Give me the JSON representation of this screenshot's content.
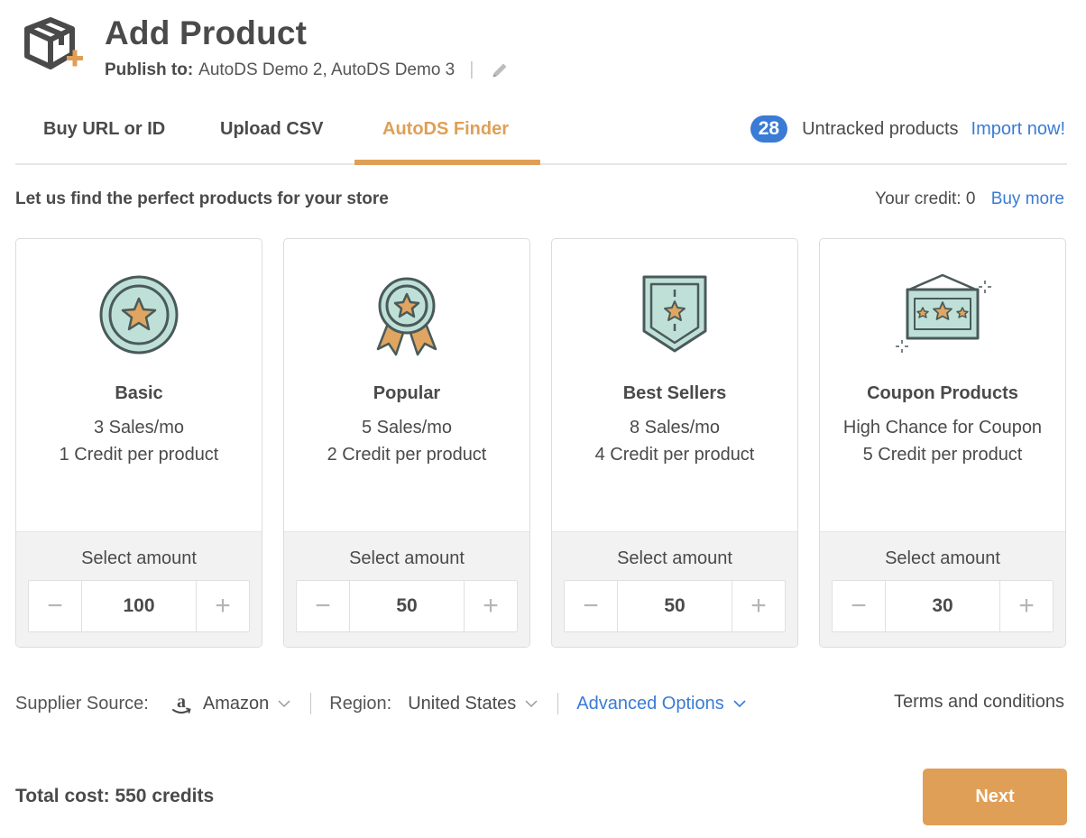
{
  "header": {
    "title": "Add Product",
    "publish_label": "Publish to:",
    "publish_stores": "AutoDS Demo 2, AutoDS Demo 3"
  },
  "tabs": [
    {
      "label": "Buy URL or ID",
      "active": false
    },
    {
      "label": "Upload CSV",
      "active": false
    },
    {
      "label": "AutoDS Finder",
      "active": true
    }
  ],
  "untracked": {
    "count": "28",
    "label": "Untracked products",
    "link": "Import now!"
  },
  "finder": {
    "subtitle": "Let us find the perfect products for your store",
    "credit_label": "Your credit: 0",
    "buy_more": "Buy more"
  },
  "cards": [
    {
      "name": "Basic",
      "line1": "3 Sales/mo",
      "line2": "1 Credit per product",
      "select_label": "Select amount",
      "amount": "100",
      "icon": "medal-star-icon"
    },
    {
      "name": "Popular",
      "line1": "5 Sales/mo",
      "line2": "2 Credit per product",
      "select_label": "Select amount",
      "amount": "50",
      "icon": "ribbon-award-icon"
    },
    {
      "name": "Best Sellers",
      "line1": "8 Sales/mo",
      "line2": "4 Credit per product",
      "select_label": "Select amount",
      "amount": "50",
      "icon": "shield-star-icon"
    },
    {
      "name": "Coupon Products",
      "line1": "High Chance for Coupon",
      "line2": "5 Credit per product",
      "select_label": "Select amount",
      "amount": "30",
      "icon": "coupon-sign-icon"
    }
  ],
  "stepper": {
    "minus": "−",
    "plus": "+"
  },
  "filters": {
    "supplier_label": "Supplier Source:",
    "supplier_value": "Amazon",
    "region_label": "Region:",
    "region_value": "United States",
    "advanced": "Advanced Options",
    "terms": "Terms and conditions"
  },
  "footer": {
    "total": "Total cost: 550 credits",
    "next": "Next"
  },
  "colors": {
    "accent": "#e09f56",
    "link": "#3a7bd5",
    "icon_fill": "#bfe0d6",
    "icon_stroke": "#4a5a5a"
  }
}
